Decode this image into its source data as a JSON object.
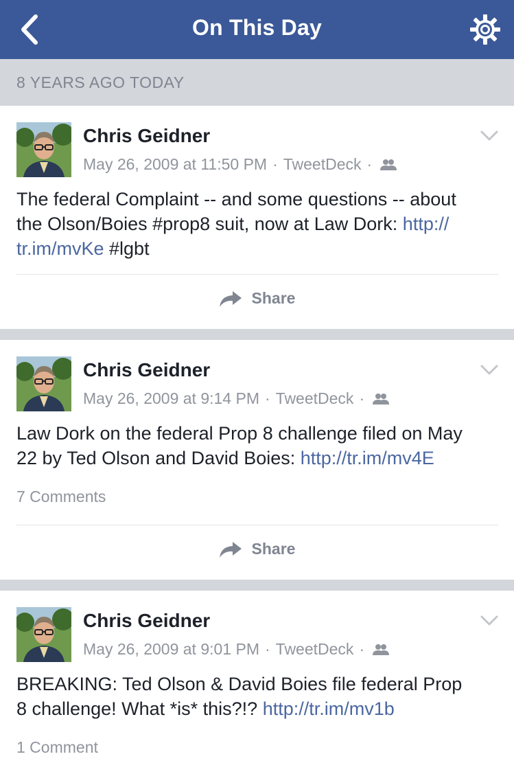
{
  "header": {
    "title": "On This Day"
  },
  "section": {
    "label": "8 YEARS AGO TODAY"
  },
  "posts": [
    {
      "author": "Chris Geidner",
      "date": "May 26, 2009 at 11:50 PM",
      "source": "TweetDeck",
      "text_line1": "The federal Complaint -- and some questions -- about",
      "text_line2": "the Olson/Boies #prop8 suit, now at Law Dork: ",
      "link_part1": "http://",
      "link_part2": "tr.im/mvKe",
      "text_after": " #lgbt",
      "share_label": "Share"
    },
    {
      "author": "Chris Geidner",
      "date": "May 26, 2009 at 9:14 PM",
      "source": "TweetDeck",
      "text_line1": "Law Dork on the federal Prop 8 challenge filed on May",
      "text_line2": "22 by Ted Olson and David Boies: ",
      "link": "http://tr.im/mv4E",
      "comments": "7 Comments",
      "share_label": "Share"
    },
    {
      "author": "Chris Geidner",
      "date": "May 26, 2009 at 9:01 PM",
      "source": "TweetDeck",
      "text_line1": "BREAKING: Ted Olson & David Boies file federal Prop",
      "text_line2": "8 challenge! What *is* this?!? ",
      "link": "http://tr.im/mv1b",
      "comments": "1 Comment"
    }
  ],
  "colors": {
    "brand": "#3b5998",
    "link": "#4b67a1",
    "meta": "#90949c",
    "background": "#d3d6db"
  }
}
